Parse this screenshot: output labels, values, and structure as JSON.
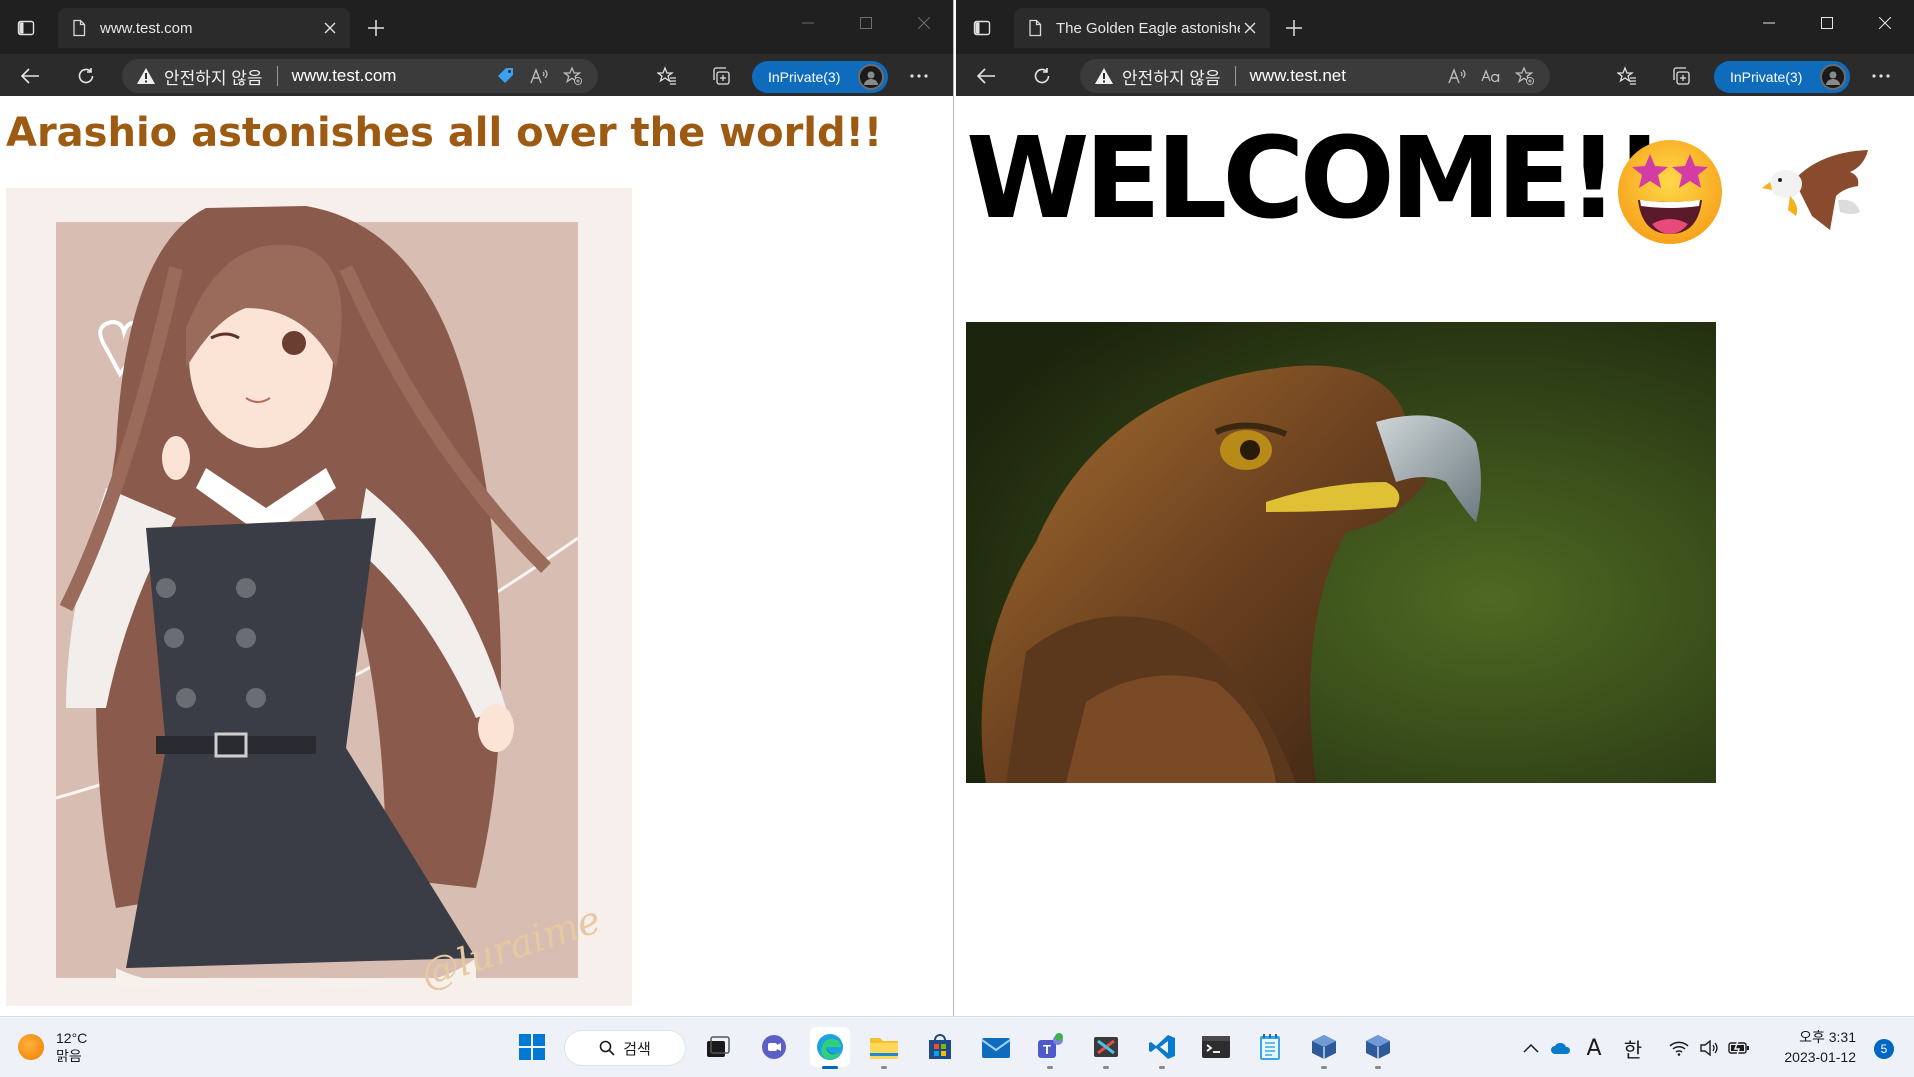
{
  "left_window": {
    "tab_title": "www.test.com",
    "security_label": "안전하지 않음",
    "url": "www.test.com",
    "inprivate_label": "InPrivate(3)",
    "heading": "Arashio astonishes all over the world!!",
    "image_signature": "@luraime"
  },
  "right_window": {
    "tab_title": "The Golden Eagle astonishes all over",
    "security_label": "안전하지 않음",
    "url": "www.test.net",
    "inprivate_label": "InPrivate(3)",
    "heading": "WELCOME!!"
  },
  "taskbar": {
    "weather_temp": "12°C",
    "weather_desc": "맑음",
    "search_label": "검색",
    "ime_mode": "A",
    "ime_lang": "한",
    "time": "오후 3:31",
    "date": "2023-01-12",
    "notification_count": "5"
  },
  "colors": {
    "browser_chrome": "#202020",
    "toolbar": "#2b2b2b",
    "inprivate_blue": "#0f6cbd",
    "left_heading": "#9c5a12",
    "taskbar_bg": "#eef2f8",
    "accent": "#0067c0"
  }
}
